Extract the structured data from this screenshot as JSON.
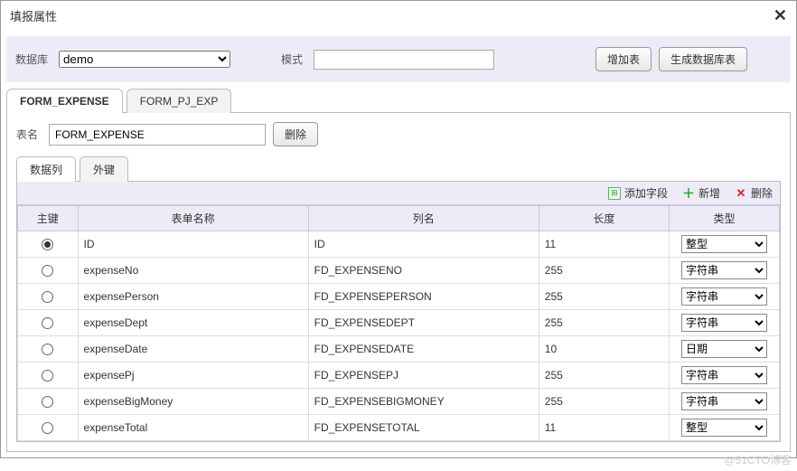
{
  "dialog": {
    "title": "填报属性"
  },
  "toolbar": {
    "db_label": "数据库",
    "db_value": "demo",
    "mode_label": "模式",
    "mode_value": "",
    "add_table_btn": "增加表",
    "gen_table_btn": "生成数据库表"
  },
  "outer_tabs": [
    {
      "label": "FORM_EXPENSE",
      "active": true
    },
    {
      "label": "FORM_PJ_EXP",
      "active": false
    }
  ],
  "form_section": {
    "table_name_label": "表名",
    "table_name_value": "FORM_EXPENSE",
    "delete_btn": "删除"
  },
  "inner_tabs": [
    {
      "label": "数据列",
      "active": true
    },
    {
      "label": "外键",
      "active": false
    }
  ],
  "grid_toolbar": {
    "add_field": "添加字段",
    "new": "新增",
    "delete": "删除"
  },
  "columns": {
    "pk": "主键",
    "form_name": "表单名称",
    "col_name": "列名",
    "length": "长度",
    "type": "类型"
  },
  "type_options": [
    "整型",
    "字符串",
    "日期"
  ],
  "rows": [
    {
      "pk": true,
      "form_name": "ID",
      "col_name": "ID",
      "length": "11",
      "type": "整型"
    },
    {
      "pk": false,
      "form_name": "expenseNo",
      "col_name": "FD_EXPENSENO",
      "length": "255",
      "type": "字符串"
    },
    {
      "pk": false,
      "form_name": "expensePerson",
      "col_name": "FD_EXPENSEPERSON",
      "length": "255",
      "type": "字符串"
    },
    {
      "pk": false,
      "form_name": "expenseDept",
      "col_name": "FD_EXPENSEDEPT",
      "length": "255",
      "type": "字符串"
    },
    {
      "pk": false,
      "form_name": "expenseDate",
      "col_name": "FD_EXPENSEDATE",
      "length": "10",
      "type": "日期"
    },
    {
      "pk": false,
      "form_name": "expensePj",
      "col_name": "FD_EXPENSEPJ",
      "length": "255",
      "type": "字符串"
    },
    {
      "pk": false,
      "form_name": "expenseBigMoney",
      "col_name": "FD_EXPENSEBIGMONEY",
      "length": "255",
      "type": "字符串"
    },
    {
      "pk": false,
      "form_name": "expenseTotal",
      "col_name": "FD_EXPENSETOTAL",
      "length": "11",
      "type": "整型"
    }
  ],
  "watermark": "@51CTO博客"
}
